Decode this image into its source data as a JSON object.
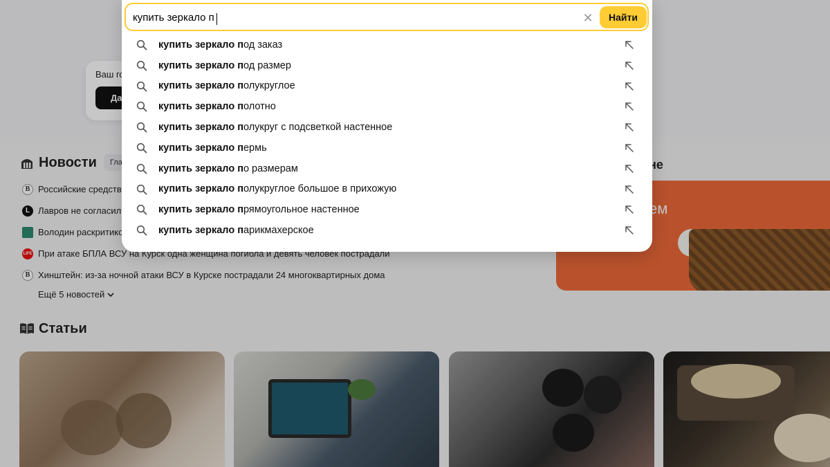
{
  "search": {
    "query": "купить зеркало п",
    "submit_label": "Найти",
    "clear_symbol": "✕"
  },
  "suggestions": [
    {
      "prefix": "купить зеркало п",
      "suffix": "од заказ"
    },
    {
      "prefix": "купить зеркало п",
      "suffix": "од размер"
    },
    {
      "prefix": "купить зеркало п",
      "suffix": "олукруглое"
    },
    {
      "prefix": "купить зеркало п",
      "suffix": "олотно"
    },
    {
      "prefix": "купить зеркало п",
      "suffix": "олукруг с подсветкой настенное"
    },
    {
      "prefix": "купить зеркало п",
      "suffix": "ермь"
    },
    {
      "prefix": "купить зеркало п",
      "suffix": "о размерам"
    },
    {
      "prefix": "купить зеркало п",
      "suffix": "олукруглое большое в прихожую"
    },
    {
      "prefix": "купить зеркало п",
      "suffix": "рямоугольное настенное"
    },
    {
      "prefix": "купить зеркало п",
      "suffix": "арикмахерское"
    }
  ],
  "promo_card": {
    "text": "Ваш го",
    "button": "Да"
  },
  "news": {
    "title": "Новости",
    "tab": "Гла",
    "items": [
      {
        "source": "B",
        "text": "Российские средства"
      },
      {
        "source": "L",
        "text": "Лавров не согласил"
      },
      {
        "source": "",
        "text": "Володин раскритико"
      },
      {
        "source": "LIFE",
        "text": "При атаке БПЛА ВСУ на Курск одна женщина погибла и девять человек пострадали"
      },
      {
        "source": "B",
        "text": "Хинштейн: из-за ночной атаки ВСУ в Курске пострадали 24 многоквартирных дома"
      }
    ],
    "more": "Ещё 5 новостей"
  },
  "articles": {
    "title": "Статьи"
  },
  "right_panel": {
    "heading": "не",
    "banner_text": "ем"
  },
  "colors": {
    "accent_yellow": "#ffcc33",
    "banner_orange": "#ee6a39"
  }
}
